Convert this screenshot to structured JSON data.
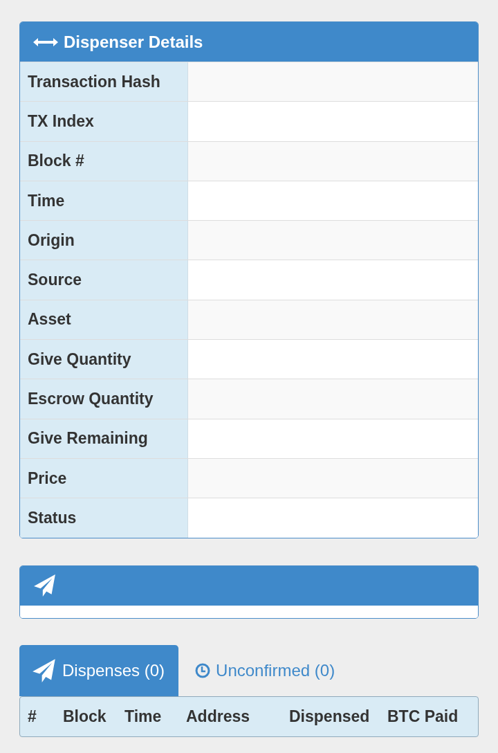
{
  "details_panel": {
    "title": "Dispenser Details",
    "rows": [
      {
        "label": "Transaction Hash"
      },
      {
        "label": "TX Index"
      },
      {
        "label": "Block #"
      },
      {
        "label": "Time"
      },
      {
        "label": "Origin"
      },
      {
        "label": "Source"
      },
      {
        "label": "Asset"
      },
      {
        "label": "Give Quantity"
      },
      {
        "label": "Escrow Quantity"
      },
      {
        "label": "Give Remaining"
      },
      {
        "label": "Price"
      },
      {
        "label": "Status"
      }
    ]
  },
  "tabs": [
    {
      "label": "Dispenses (0)",
      "selected": true
    },
    {
      "label": "Unconfirmed (0)",
      "selected": false
    }
  ],
  "table": {
    "columns": [
      "#",
      "Block",
      "Time",
      "Address",
      "Dispensed",
      "BTC Paid"
    ]
  }
}
